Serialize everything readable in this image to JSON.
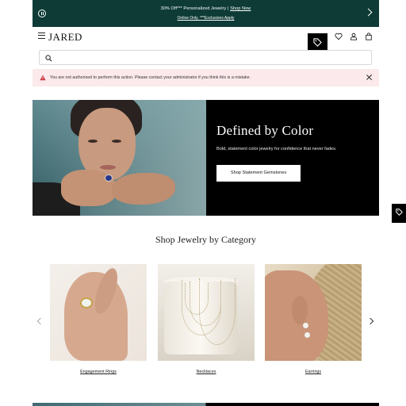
{
  "promo": {
    "text": "30% Off*** Personalized Jewelry",
    "separator": " | ",
    "link": "Shop Now",
    "subtext": "Online Only. ***Exclusions Apply"
  },
  "header": {
    "logo": "JARED"
  },
  "search": {
    "placeholder": ""
  },
  "alert": {
    "message": "You are not authorized to perform this action. Please contact your administrator if you think this is a mistake."
  },
  "hero": {
    "title": "Defined by Color",
    "subtitle": "Bold, statement color jewelry for confidence that never fades.",
    "button": "Shop Statement Gemstones"
  },
  "categories": {
    "heading": "Shop Jewelry by Category",
    "items": [
      {
        "label": "Engagement Rings"
      },
      {
        "label": "Necklaces"
      },
      {
        "label": "Earrings"
      }
    ]
  },
  "colors": {
    "promo_bg": "#0e3b36",
    "alert_bg": "#fbe9ec",
    "hero_panel": "#000000"
  },
  "icons": [
    "pause-icon",
    "chevron-right-icon",
    "menu-icon",
    "tag-icon",
    "heart-icon",
    "account-icon",
    "bag-icon",
    "search-icon",
    "warning-icon",
    "close-icon",
    "chevron-left-icon"
  ]
}
